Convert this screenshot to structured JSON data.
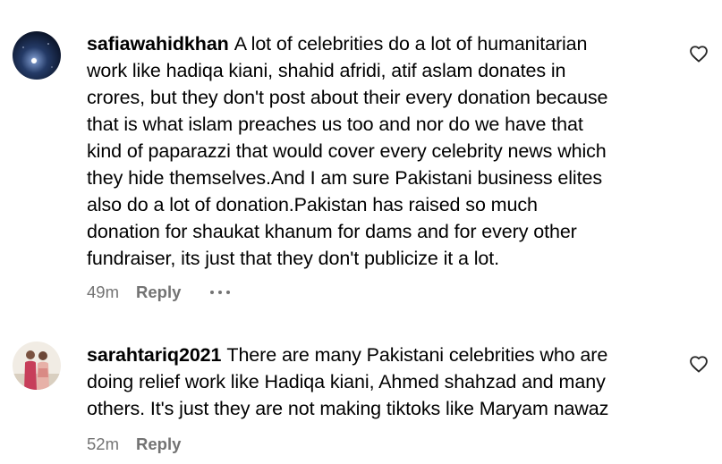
{
  "comments": [
    {
      "username": "safiawahidkhan",
      "lines": [
        "A lot of celebrities do a lot of humanitarian",
        "work like hadiqa kiani, shahid afridi, atif aslam donates in",
        "crores, but they don't post about their every donation because",
        "that is what islam preaches us too and nor do we have that",
        "kind of paparazzi that would cover every celebrity news which",
        "they hide themselves.And I am sure Pakistani business elites",
        "also do a lot of donation.Pakistan has raised so much",
        "donation for shaukat khanum for dams and for every other",
        "fundraiser, its just that they don't publicize it a lot."
      ],
      "time": "49m",
      "reply_label": "Reply",
      "icons": {
        "avatar": "avatar-night-sky",
        "like": "heart-outline-icon",
        "more": "more-options-icon"
      }
    },
    {
      "username": "sarahtariq2021",
      "lines": [
        "There are many Pakistani celebrities who are",
        "doing relief work like Hadiqa kiani, Ahmed shahzad and many",
        "others. It's just they are not making tiktoks like Maryam nawaz"
      ],
      "time": "52m",
      "reply_label": "Reply",
      "icons": {
        "avatar": "avatar-two-people-photo",
        "like": "heart-outline-icon"
      }
    }
  ],
  "colors": {
    "text": "#000000",
    "secondary": "#737373",
    "background": "#ffffff"
  }
}
